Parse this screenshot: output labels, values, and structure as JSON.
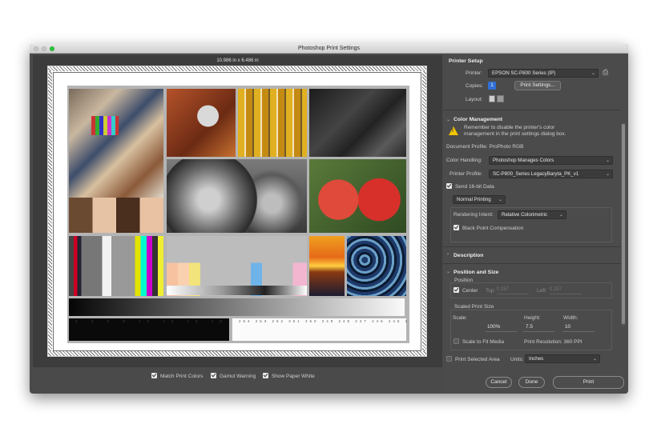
{
  "window": {
    "title": "Photoshop Print Settings"
  },
  "preview": {
    "dimensions": "10.986 in x 6.486 in",
    "strip_numbers_top": [
      "2",
      "4",
      "6",
      "8",
      "10",
      "12",
      "14",
      "16",
      "18",
      "20",
      "22",
      "24"
    ],
    "strip_numbers_bottom": [
      "254",
      "253",
      "252",
      "251",
      "250",
      "249",
      "248",
      "247",
      "246",
      "245",
      "244",
      "243"
    ]
  },
  "options": {
    "match_print_colors": "Match Print Colors",
    "gamut_warning": "Gamut Warning",
    "show_paper_white": "Show Paper White"
  },
  "printer_setup": {
    "header": "Printer Setup",
    "printer_label": "Printer:",
    "printer_value": "EPSON SC-P800 Series (IP)",
    "copies_label": "Copies:",
    "copies_value": "1",
    "print_settings_button": "Print Settings...",
    "layout_label": "Layout:"
  },
  "color_management": {
    "header": "Color Management",
    "warning_text_1": "Remember to disable the printer's color",
    "warning_text_2": "management in the print settings dialog box.",
    "document_profile": "Document Profile: ProPhoto RGB",
    "color_handling_label": "Color Handling:",
    "color_handling_value": "Photoshop Manages Colors",
    "printer_profile_label": "Printer Profile:",
    "printer_profile_value": "SC-P800_Series LegacyBaryta_PK_v1",
    "send16": "Send 16-bit Data",
    "normal_printing": "Normal Printing",
    "rendering_intent_label": "Rendering Intent:",
    "rendering_intent_value": "Relative Colorimetric",
    "black_point": "Black Point Compensation"
  },
  "description": {
    "header": "Description"
  },
  "position_size": {
    "header": "Position and Size",
    "position_label": "Position",
    "center_label": "Center",
    "top_label": "Top:",
    "top_value": "0.257",
    "left_label": "Left:",
    "left_value": "0.257",
    "scaled_print_size": "Scaled Print Size",
    "scale_label": "Scale:",
    "scale_value": "100%",
    "height_label": "Height:",
    "height_value": "7.5",
    "width_label": "Width:",
    "width_value": "10",
    "scale_to_fit": "Scale to Fit Media",
    "print_resolution": "Print Resolution: 360 PPI",
    "print_selected_area": "Print Selected Area",
    "units_label": "Units:",
    "units_value": "Inches"
  },
  "buttons": {
    "cancel": "Cancel",
    "done": "Done",
    "print": "Print"
  },
  "colors": {
    "accent": "#2bc840",
    "panel_bg": "#4b4b4b",
    "window_bg": "#4a4a4a"
  }
}
